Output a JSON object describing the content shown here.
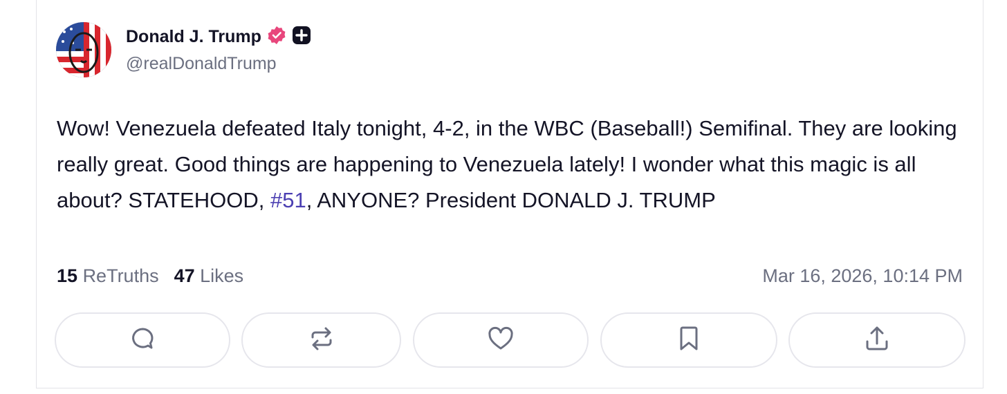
{
  "post": {
    "author": {
      "display_name": "Donald J. Trump",
      "handle": "@realDonaldTrump",
      "verified_badge_color": "#e8467c",
      "plus_badge_color": "#111122"
    },
    "text_before_hashtag": "Wow! Venezuela defeated Italy tonight, 4-2, in the WBC (Baseball!) Semifinal. They are looking really great. Good things are happening to Venezuela lately! I wonder what this magic is all about? STATEHOOD, ",
    "hashtag": "#51",
    "text_after_hashtag": ", ANYONE? President DONALD J. TRUMP",
    "hashtag_color": "#4b3fb2",
    "retruths_count": "15",
    "retruths_label": "ReTruths",
    "likes_count": "47",
    "likes_label": "Likes",
    "timestamp": "Mar 16, 2026, 10:14 PM"
  },
  "actions": [
    {
      "icon": "reply-icon"
    },
    {
      "icon": "retruth-icon"
    },
    {
      "icon": "like-icon"
    },
    {
      "icon": "bookmark-icon"
    },
    {
      "icon": "share-icon"
    }
  ]
}
